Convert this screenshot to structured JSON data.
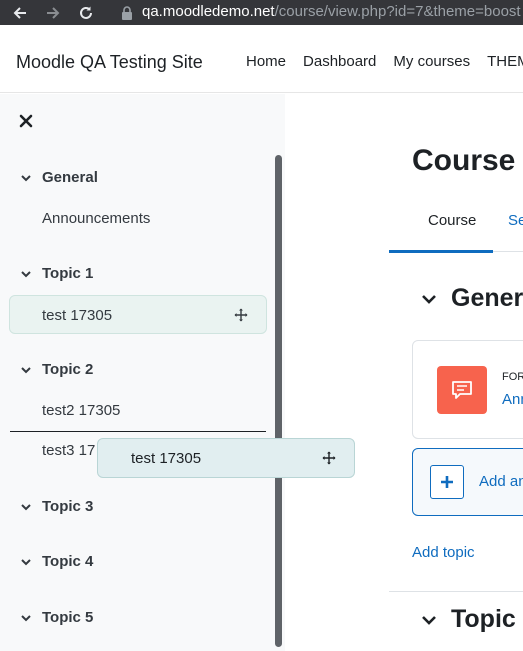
{
  "browser": {
    "url_host": "qa.moodledemo.net",
    "url_path": "/course/view.php?id=7&theme=boost"
  },
  "header": {
    "site_name": "Moodle QA Testing Site",
    "nav": [
      "Home",
      "Dashboard",
      "My courses",
      "THEM"
    ]
  },
  "drawer": {
    "sections": [
      "General",
      "Topic 1",
      "Topic 2",
      "Topic 3",
      "Topic 4",
      "Topic 5"
    ],
    "items": {
      "announcements": "Announcements",
      "test_17305": "test 17305",
      "test2": "test2 17305",
      "test3": "test3 17"
    },
    "drag_ghost_label": "test 17305"
  },
  "main": {
    "page_title": "Course",
    "tabs": [
      "Course",
      "Se"
    ],
    "section_general": "Gener",
    "activity": {
      "type": "FOR",
      "name": "Ann"
    },
    "add_activity": "Add an",
    "add_topic": "Add topic",
    "section_topic": "Topic"
  },
  "colors": {
    "accent": "#0f6cbf",
    "forum_icon": "#f7634d",
    "drawer_bg": "#f8f9fa",
    "highlight": "#eaf3f1"
  }
}
